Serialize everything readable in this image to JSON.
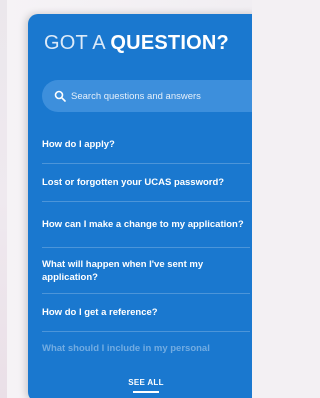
{
  "widget": {
    "title_prefix": "GOT A ",
    "title_bold": "QUESTION?",
    "accent_color": "#1a78cf"
  },
  "search": {
    "placeholder": "Search questions and answers",
    "icon": "search-icon"
  },
  "faq_items": [
    {
      "label": "How do I apply?"
    },
    {
      "label": "Lost or forgotten your UCAS password?"
    },
    {
      "label": "How can I make a change to my application?"
    },
    {
      "label": "What will happen when I've sent my application?"
    },
    {
      "label": "How do I get a reference?"
    },
    {
      "label": "What should I include in my personal"
    }
  ],
  "footer": {
    "see_all_label": "SEE ALL"
  }
}
